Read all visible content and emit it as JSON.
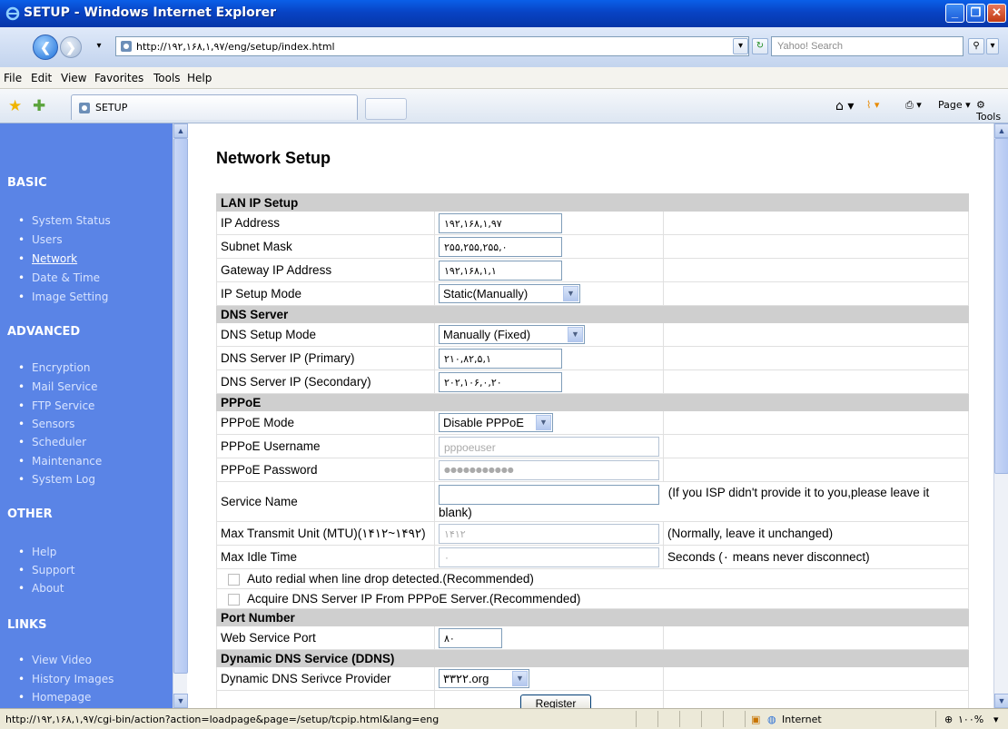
{
  "window": {
    "title": "SETUP - Windows Internet Explorer"
  },
  "address": {
    "url": "http://۱۹۲,۱۶۸,۱,۹۷/eng/setup/index.html"
  },
  "search": {
    "placeholder": "Yahoo! Search"
  },
  "menu": [
    "File",
    "Edit",
    "View",
    "Favorites",
    "Tools",
    "Help"
  ],
  "tab": {
    "label": "SETUP"
  },
  "toolbar": {
    "page_label": "Page",
    "tools_label": "Tools"
  },
  "sidebar": {
    "sections": [
      {
        "title": "BASIC",
        "items": [
          "System Status",
          "Users",
          "Network",
          "Date & Time",
          "Image Setting"
        ]
      },
      {
        "title": "ADVANCED",
        "items": [
          "Encryption",
          "Mail Service",
          "FTP Service",
          "Sensors",
          "Scheduler",
          "Maintenance",
          "System Log"
        ]
      },
      {
        "title": "OTHER",
        "items": [
          "Help",
          "Support",
          "About"
        ]
      },
      {
        "title": "LINKS",
        "items": [
          "View Video",
          "History Images",
          "Homepage"
        ]
      }
    ]
  },
  "page": {
    "title": "Network Setup"
  },
  "lan": {
    "header": "LAN IP Setup",
    "ip_label": "IP Address",
    "ip_value": "۱۹۲,۱۶۸,۱,۹۷",
    "mask_label": "Subnet Mask",
    "mask_value": "۲۵۵,۲۵۵,۲۵۵,۰",
    "gw_label": "Gateway IP Address",
    "gw_value": "۱۹۲,۱۶۸,۱,۱",
    "mode_label": "IP Setup Mode",
    "mode_value": "Static(Manually)"
  },
  "dns": {
    "header": "DNS Server",
    "mode_label": "DNS Setup Mode",
    "mode_value": "Manually (Fixed)",
    "primary_label": "DNS Server IP (Primary)",
    "primary_value": "۲۱۰,۸۲,۵,۱",
    "secondary_label": "DNS Server IP (Secondary)",
    "secondary_value": "۲۰۲,۱۰۶,۰,۲۰"
  },
  "pppoe": {
    "header": "PPPoE",
    "mode_label": "PPPoE Mode",
    "mode_value": "Disable PPPoE",
    "user_label": "PPPoE Username",
    "user_value": "pppoeuser",
    "pass_label": "PPPoE Password",
    "pass_value": "●●●●●●●●●●●",
    "service_label": "Service Name",
    "service_note": "(If you ISP didn't provide it to you,please leave it blank)",
    "mtu_label": "Max Transmit Unit (MTU)(۱۴۱۲~۱۴۹۲)",
    "mtu_value": "۱۴۱۲",
    "mtu_note": "(Normally, leave it unchanged)",
    "idle_label": "Max Idle Time",
    "idle_value": "۰",
    "idle_note": "Seconds (۰ means never disconnect)",
    "redial_label": "Auto redial when line drop detected.(Recommended)",
    "acquire_label": "Acquire DNS Server IP From PPPoE Server.(Recommended)"
  },
  "port": {
    "header": "Port Number",
    "web_label": "Web Service Port",
    "web_value": "۸۰"
  },
  "ddns": {
    "header": "Dynamic DNS Service (DDNS)",
    "provider_label": "Dynamic DNS Serivce Provider",
    "provider_value": "۳۳۲۲.org",
    "register_label": "Register"
  },
  "status": {
    "url": "http://۱۹۲,۱۶۸,۱,۹۷/cgi-bin/action?action=loadpage&page=/setup/tcpip.html&lang=eng",
    "zone": "Internet",
    "zoom": "۱۰۰%"
  }
}
